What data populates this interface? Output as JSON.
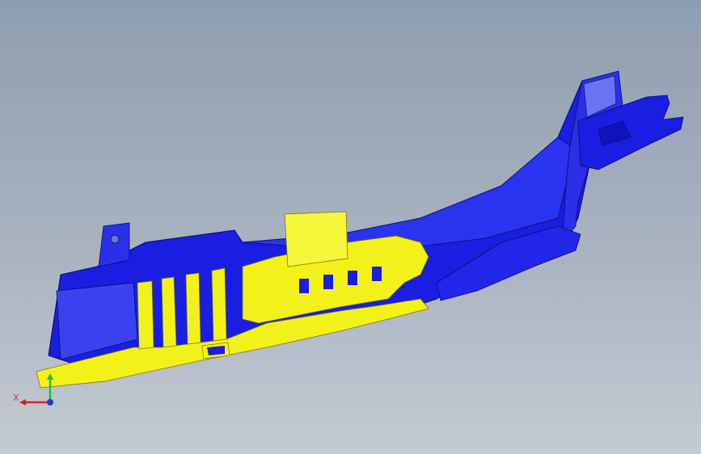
{
  "viewport": {
    "background_top": "#8e9db0",
    "background_bottom": "#c4cad3"
  },
  "model": {
    "primary_color": "#1a1ee0",
    "secondary_color": "#f2f21a",
    "edge_color": "#0a0a6a"
  },
  "triad": {
    "x_label": "X",
    "x_color": "#e0201a",
    "y_color": "#1ec21e",
    "z_color": "#1a3ae0"
  }
}
